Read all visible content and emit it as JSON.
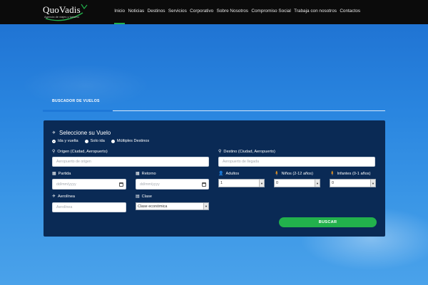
{
  "brand": {
    "name": "QuoVadis",
    "tagline": "Agencia de viajes y turismo"
  },
  "nav": {
    "items": [
      "Inicio",
      "Noticias",
      "Destinos",
      "Servicios",
      "Corporativo",
      "Sobre Nosotros",
      "Compromiso Social",
      "Trabaja con nosotros",
      "Contactos"
    ],
    "active_index": 0
  },
  "tab": {
    "label": "BUSCADOR DE VUELOS"
  },
  "form": {
    "title": "Seleccione su Vuelo",
    "trip_types": [
      "Ida y vuelta",
      "Solo ida",
      "Múltiples Destinos"
    ],
    "trip_type_selected": "Ida y vuelta",
    "origin": {
      "label": "Origen (Ciudad, Aeropuerto)",
      "placeholder": "Aeropuerto de origen"
    },
    "destination": {
      "label": "Destino (Ciudad, Aeropuerto)",
      "placeholder": "Aeropuerto de llegada"
    },
    "departure": {
      "label": "Partida",
      "placeholder": "dd/mm/yyyy"
    },
    "return": {
      "label": "Retorno",
      "placeholder": "dd/mm/yyyy"
    },
    "adults": {
      "label": "Adultos",
      "value": "1"
    },
    "children": {
      "label": "Niños (2-12 años)",
      "value": "0"
    },
    "infants": {
      "label": "Infantes (0-1 años)",
      "value": "0"
    },
    "airline": {
      "label": "Aerolínea",
      "placeholder": "Aerolínea"
    },
    "class": {
      "label": "Clase",
      "value": "Clase económica"
    },
    "submit_label": "BUSCAR"
  },
  "colors": {
    "accent_green": "#22b14c",
    "panel_navy": "#0a2a55",
    "nav_bg": "#0b0b0b",
    "sky_blue": "#2a86e0"
  },
  "icons": {
    "plane": "plane-icon",
    "marker": "map-marker-icon",
    "calendar": "calendar-icon",
    "user": "user-icon",
    "child": "child-icon",
    "id_card": "id-card-icon"
  }
}
